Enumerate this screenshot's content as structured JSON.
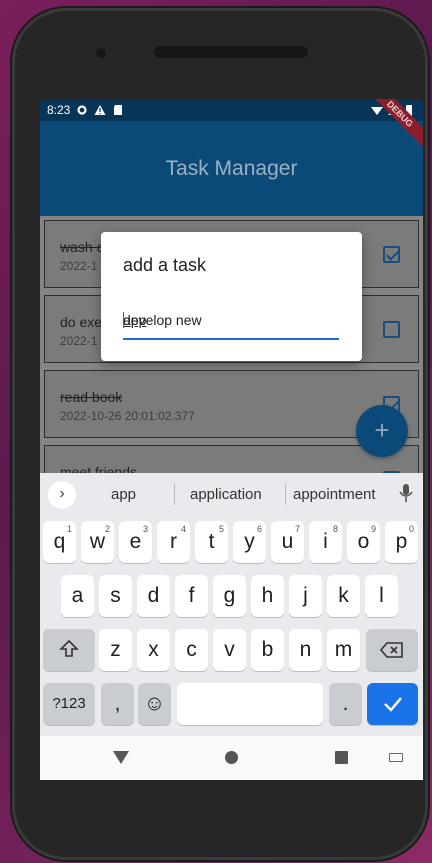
{
  "statusbar": {
    "time": "8:23",
    "debug_label": "DEBUG"
  },
  "appbar": {
    "title": "Task Manager"
  },
  "tasks": [
    {
      "name": "wash c",
      "date": "2022-1",
      "done": true,
      "checked": true
    },
    {
      "name": "do exe",
      "date": "2022-1",
      "done": false,
      "checked": false
    },
    {
      "name": "read book",
      "date": "2022-10-26 20:01:02.377",
      "done": true,
      "checked": true
    },
    {
      "name": "meet friends",
      "date": "",
      "done": false,
      "checked": false
    }
  ],
  "fab": {
    "label": "+"
  },
  "dialog": {
    "title": "add a task",
    "input_prefix": "develop new ",
    "input_composing": "app"
  },
  "keyboard": {
    "suggestions": [
      "app",
      "application",
      "appointment"
    ],
    "row1": [
      {
        "k": "q",
        "n": "1"
      },
      {
        "k": "w",
        "n": "2"
      },
      {
        "k": "e",
        "n": "3"
      },
      {
        "k": "r",
        "n": "4"
      },
      {
        "k": "t",
        "n": "5"
      },
      {
        "k": "y",
        "n": "6"
      },
      {
        "k": "u",
        "n": "7"
      },
      {
        "k": "i",
        "n": "8"
      },
      {
        "k": "o",
        "n": "9"
      },
      {
        "k": "p",
        "n": "0"
      }
    ],
    "row2": [
      "a",
      "s",
      "d",
      "f",
      "g",
      "h",
      "j",
      "k",
      "l"
    ],
    "row3": [
      "z",
      "x",
      "c",
      "v",
      "b",
      "n",
      "m"
    ],
    "symbols_label": "?123",
    "comma_label": ",",
    "period_label": ".",
    "emoji": "☺"
  },
  "colors": {
    "primary": "#0b4a78",
    "accent": "#1a73e8",
    "checkbox": "#194e7c"
  }
}
